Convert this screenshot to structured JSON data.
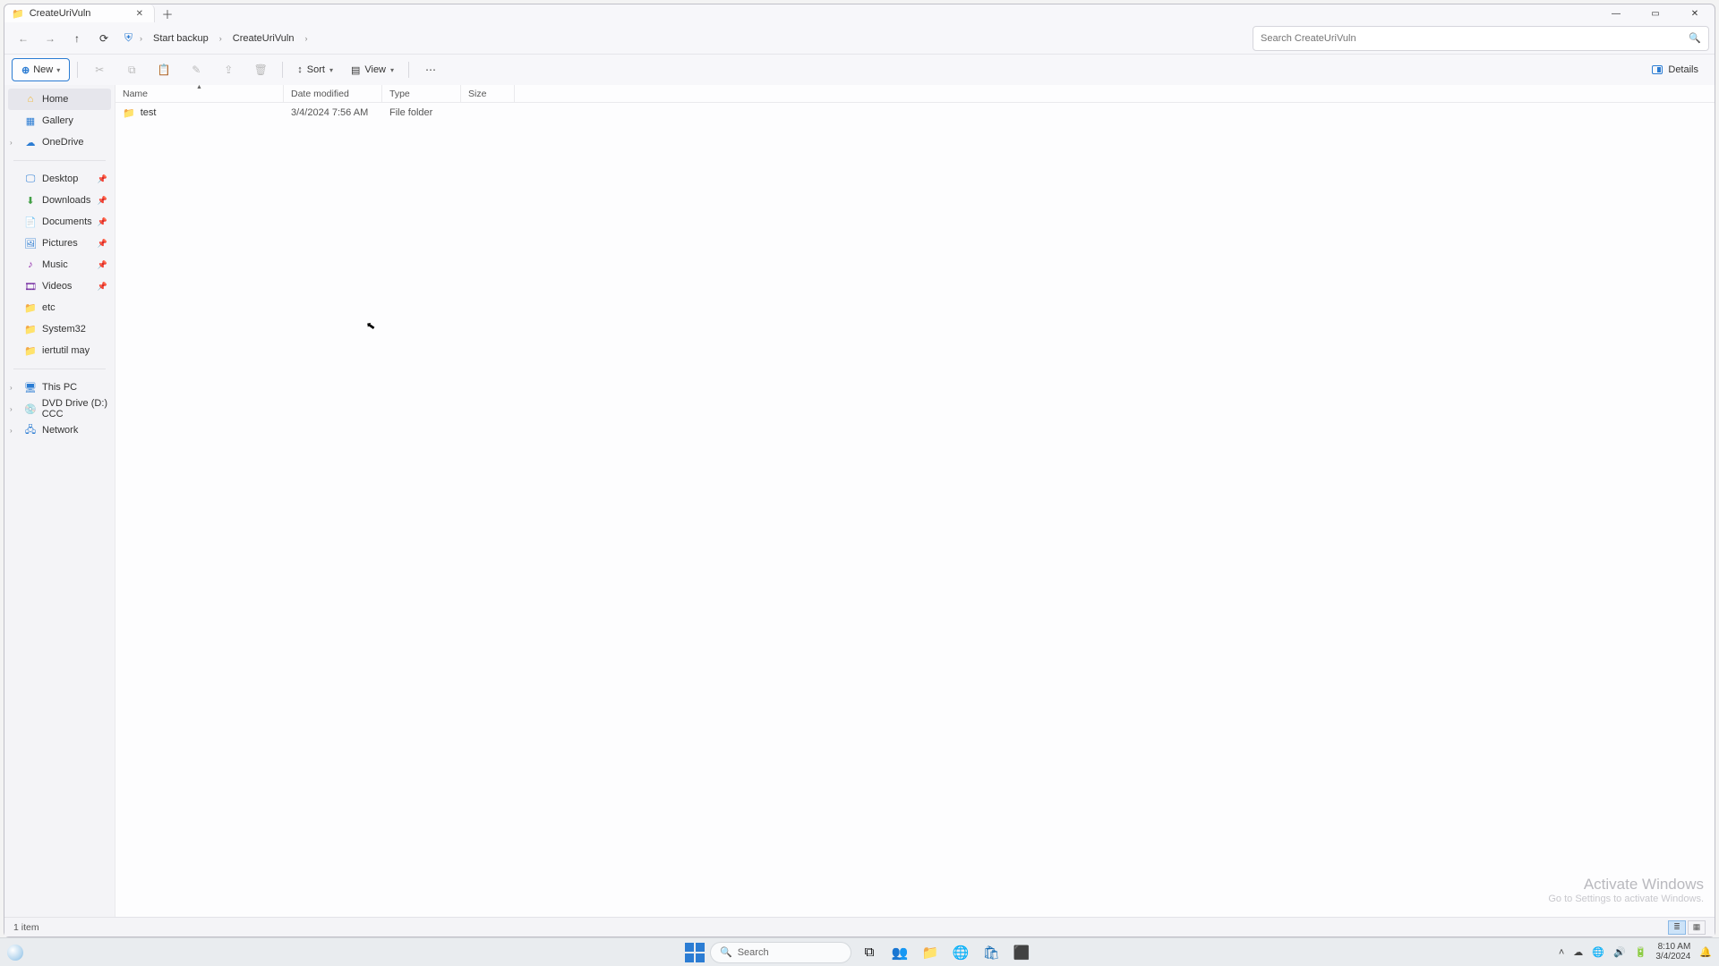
{
  "tab": {
    "title": "CreateUriVuln"
  },
  "toolbar": {
    "new_label": "New",
    "sort_label": "Sort",
    "view_label": "View",
    "details_label": "Details"
  },
  "breadcrumb": {
    "seg1": "Start backup",
    "seg2": "CreateUriVuln"
  },
  "search": {
    "placeholder": "Search CreateUriVuln"
  },
  "sidebar": {
    "home": "Home",
    "gallery": "Gallery",
    "onedrive": "OneDrive",
    "desktop": "Desktop",
    "downloads": "Downloads",
    "documents": "Documents",
    "pictures": "Pictures",
    "music": "Music",
    "videos": "Videos",
    "etc": "etc",
    "system32": "System32",
    "iertutil": "iertutil may",
    "thispc": "This PC",
    "dvd": "DVD Drive (D:) CCC",
    "network": "Network"
  },
  "columns": {
    "name": "Name",
    "date": "Date modified",
    "type": "Type",
    "size": "Size"
  },
  "rows": [
    {
      "name": "test",
      "date": "3/4/2024 7:56 AM",
      "type": "File folder",
      "size": ""
    }
  ],
  "status": {
    "count": "1 item"
  },
  "watermark": {
    "line1": "Activate Windows",
    "line2": "Go to Settings to activate Windows."
  },
  "taskbar": {
    "search_placeholder": "Search",
    "clock_time": "8:10 AM",
    "clock_date": "3/4/2024"
  }
}
